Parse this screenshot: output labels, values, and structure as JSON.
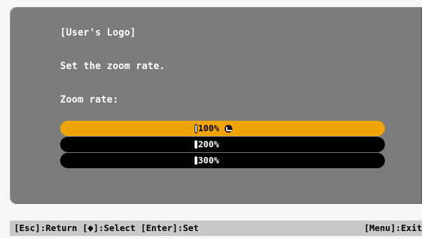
{
  "panel": {
    "title": "[User's Logo]",
    "instruction": "Set the zoom rate.",
    "field_label": "Zoom rate:"
  },
  "zoom_options": [
    {
      "label": "100%",
      "selected": true
    },
    {
      "label": "200%",
      "selected": false
    },
    {
      "label": "300%",
      "selected": false
    }
  ],
  "footer": {
    "esc": "[Esc]:Return",
    "select_prefix": "[",
    "select_icon": "updown-icon",
    "select_suffix": "]:Select",
    "enter": "[Enter]:Set",
    "menu": "[Menu]:Exit"
  },
  "colors": {
    "panel": "#7b7b7b",
    "highlight": "#f0a40c",
    "option_bg": "#000000",
    "footer_bg": "#c9c9c9"
  }
}
